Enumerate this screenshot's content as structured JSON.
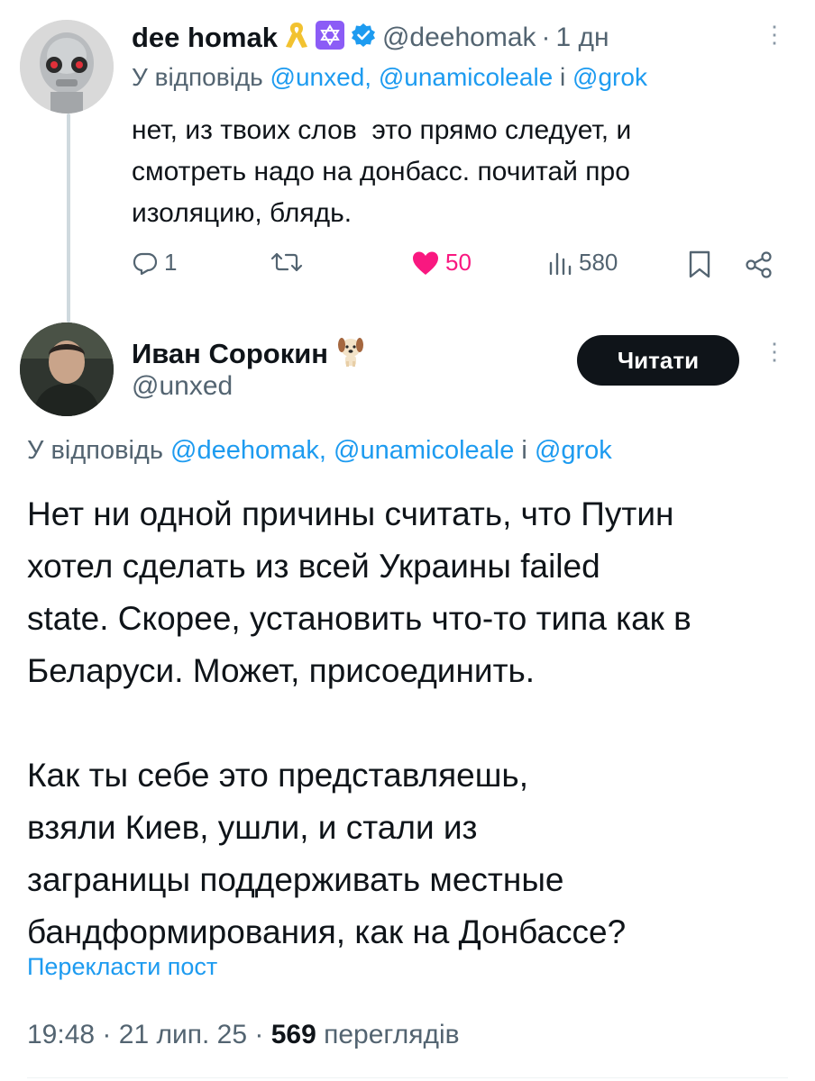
{
  "tweet1": {
    "display_name": "dee homak",
    "handle": "@deehomak",
    "separator": "·",
    "time_ago": "1 дн",
    "reply_prefix": "У відповідь",
    "mention_1": "@unxed,",
    "mention_2": "@unamicoleale",
    "mention_joiner": "і",
    "mention_3": "@grok",
    "text_lines": [
      "нет, из твоих слов  это прямо следует, и",
      "смотреть надо на донбасс. почитай про",
      "изоляцию, блядь."
    ],
    "replies": "1",
    "likes": "50",
    "views": "580",
    "liked": true,
    "like_color": "#f91880"
  },
  "tweet2": {
    "display_name": "Иван Сорокин",
    "handle": "@unxed",
    "follow_label": "Читати",
    "reply_prefix": "У відповідь",
    "mention_1": "@deehomak,",
    "mention_2": "@unamicoleale",
    "mention_joiner": "і",
    "mention_3": "@grok",
    "paragraph1_lines": [
      "Нет ни одной причины считать, что Путин",
      "хотел сделать из всей Украины failed",
      "state. Скорее, установить что-то типа как в",
      "Беларуси. Может, присоединить."
    ],
    "paragraph2_lines": [
      "Как ты себе это представляешь,",
      "взяли Киев, ушли, и стали из",
      "заграницы поддерживать местные",
      "бандформирования, как на Донбассе?"
    ],
    "translate_label": "Перекласти пост",
    "time": "19:48",
    "date": "21 лип. 25",
    "separator": "·",
    "views_count": "569",
    "views_label": "переглядів"
  },
  "colors": {
    "accent": "#1d9bf0",
    "text": "#0f1419",
    "muted": "#536471",
    "verified": "#1d9bf0"
  },
  "icons": [
    "reply-icon",
    "retweet-icon",
    "heart-icon",
    "views-icon",
    "bookmark-icon",
    "share-icon",
    "verified-badge-icon",
    "ribbon-icon",
    "star-of-david-icon",
    "dog-emoji-icon",
    "more-icon"
  ]
}
